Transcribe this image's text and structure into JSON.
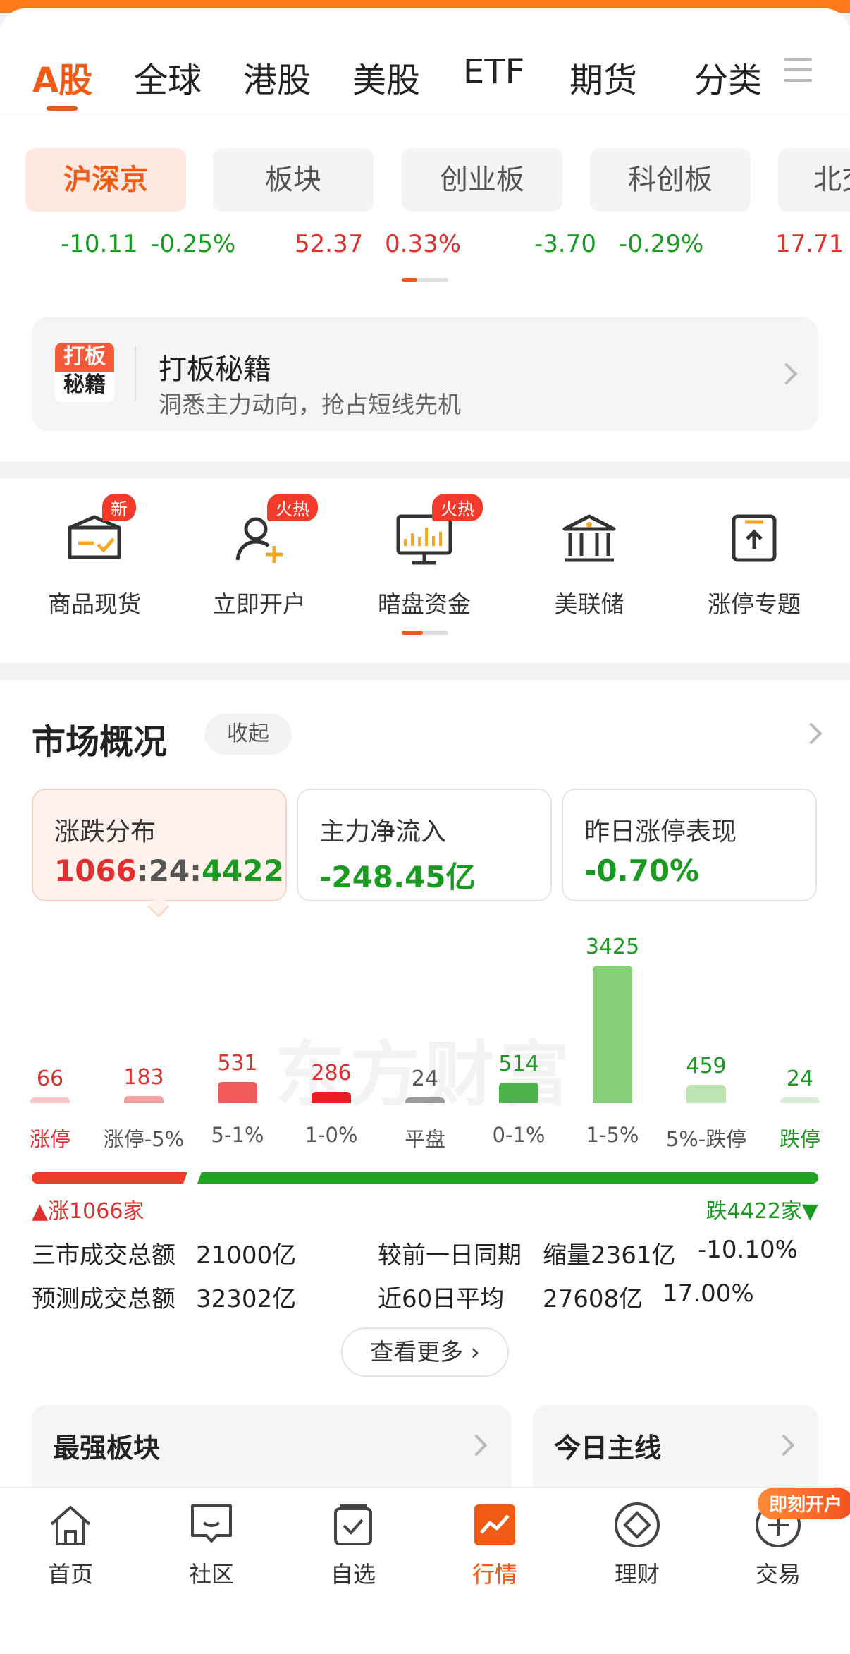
{
  "market_tabs": [
    "A股",
    "全球",
    "港股",
    "美股",
    "ETF",
    "期货",
    "分类"
  ],
  "indices": [
    {
      "name": "沪深京",
      "change": "-10.11",
      "pct": "-0.25%",
      "dir": "down",
      "active": true
    },
    {
      "name": "板块",
      "change": "52.37",
      "pct": "0.33%",
      "dir": "up",
      "active": false
    },
    {
      "name": "创业板",
      "change": "-3.70",
      "pct": "-0.29%",
      "dir": "down",
      "active": false
    },
    {
      "name": "科创板",
      "change": "",
      "pct": "17.71",
      "dir": "up",
      "active": false
    },
    {
      "name": "北交",
      "change": "",
      "pct": "",
      "dir": "up",
      "active": false
    }
  ],
  "banner": {
    "logo_line1": "打板",
    "logo_line2": "秘籍",
    "title": "打板秘籍",
    "subtitle": "洞悉主力动向，抢占短线先机"
  },
  "quick_items": [
    {
      "label": "商品现货",
      "badge": "新",
      "icon": "crate-icon"
    },
    {
      "label": "立即开户",
      "badge": "火热",
      "icon": "user-add-icon"
    },
    {
      "label": "暗盘资金",
      "badge": "火热",
      "icon": "monitor-chart-icon"
    },
    {
      "label": "美联储",
      "badge": "",
      "icon": "bank-icon"
    },
    {
      "label": "涨停专题",
      "badge": "",
      "icon": "upload-box-icon"
    }
  ],
  "overview": {
    "title": "市场概况",
    "collapse_label": "收起",
    "cards": [
      {
        "title": "涨跌分布",
        "value_up": "1066",
        "value_flat": "24",
        "value_down": "4422"
      },
      {
        "title": "主力净流入",
        "value": "-248.45亿"
      },
      {
        "title": "昨日涨停表现",
        "value": "-0.70%"
      }
    ],
    "watermark": "东方财富",
    "up_label": "涨1066家",
    "down_label": "跌4422家",
    "up_ratio": 0.195,
    "stats": {
      "total_label": "三市成交总额",
      "total_value": "21000亿",
      "forecast_label": "预测成交总额",
      "forecast_value": "32302亿",
      "prev_label": "较前一日同期",
      "prev_value": "缩量2361亿",
      "prev_pct": "-10.10%",
      "avg_label": "近60日平均",
      "avg_value": "27608亿",
      "avg_pct": "17.00%"
    },
    "more_label": "查看更多",
    "strongest_label": "最强板块",
    "mainline_label": "今日主线"
  },
  "chart_data": {
    "type": "bar",
    "categories": [
      "涨停",
      "涨停-5%",
      "5-1%",
      "1-0%",
      "平盘",
      "0-1%",
      "1-5%",
      "5%-跌停",
      "跌停"
    ],
    "values": [
      66,
      183,
      531,
      286,
      24,
      514,
      3425,
      459,
      24
    ],
    "colors": [
      "#f8c6c6",
      "#f4a0a0",
      "#f05a5a",
      "#e81e1e",
      "#9a9a9a",
      "#4cb24c",
      "#86cf76",
      "#bde3b2",
      "#d8eed4"
    ],
    "value_colors": [
      "#e03030",
      "#e03030",
      "#e03030",
      "#e03030",
      "#555555",
      "#1a9a20",
      "#1a9a20",
      "#1a9a20",
      "#1a9a20"
    ]
  },
  "bottom_nav": [
    {
      "label": "首页",
      "icon": "home-icon"
    },
    {
      "label": "社区",
      "icon": "chat-icon"
    },
    {
      "label": "自选",
      "icon": "checkbox-icon"
    },
    {
      "label": "行情",
      "icon": "chart-icon",
      "active": true
    },
    {
      "label": "理财",
      "icon": "diamond-icon"
    },
    {
      "label": "交易",
      "icon": "plus-circle-icon"
    }
  ],
  "open_badge": "即刻开户",
  "accent": "#f05a14"
}
